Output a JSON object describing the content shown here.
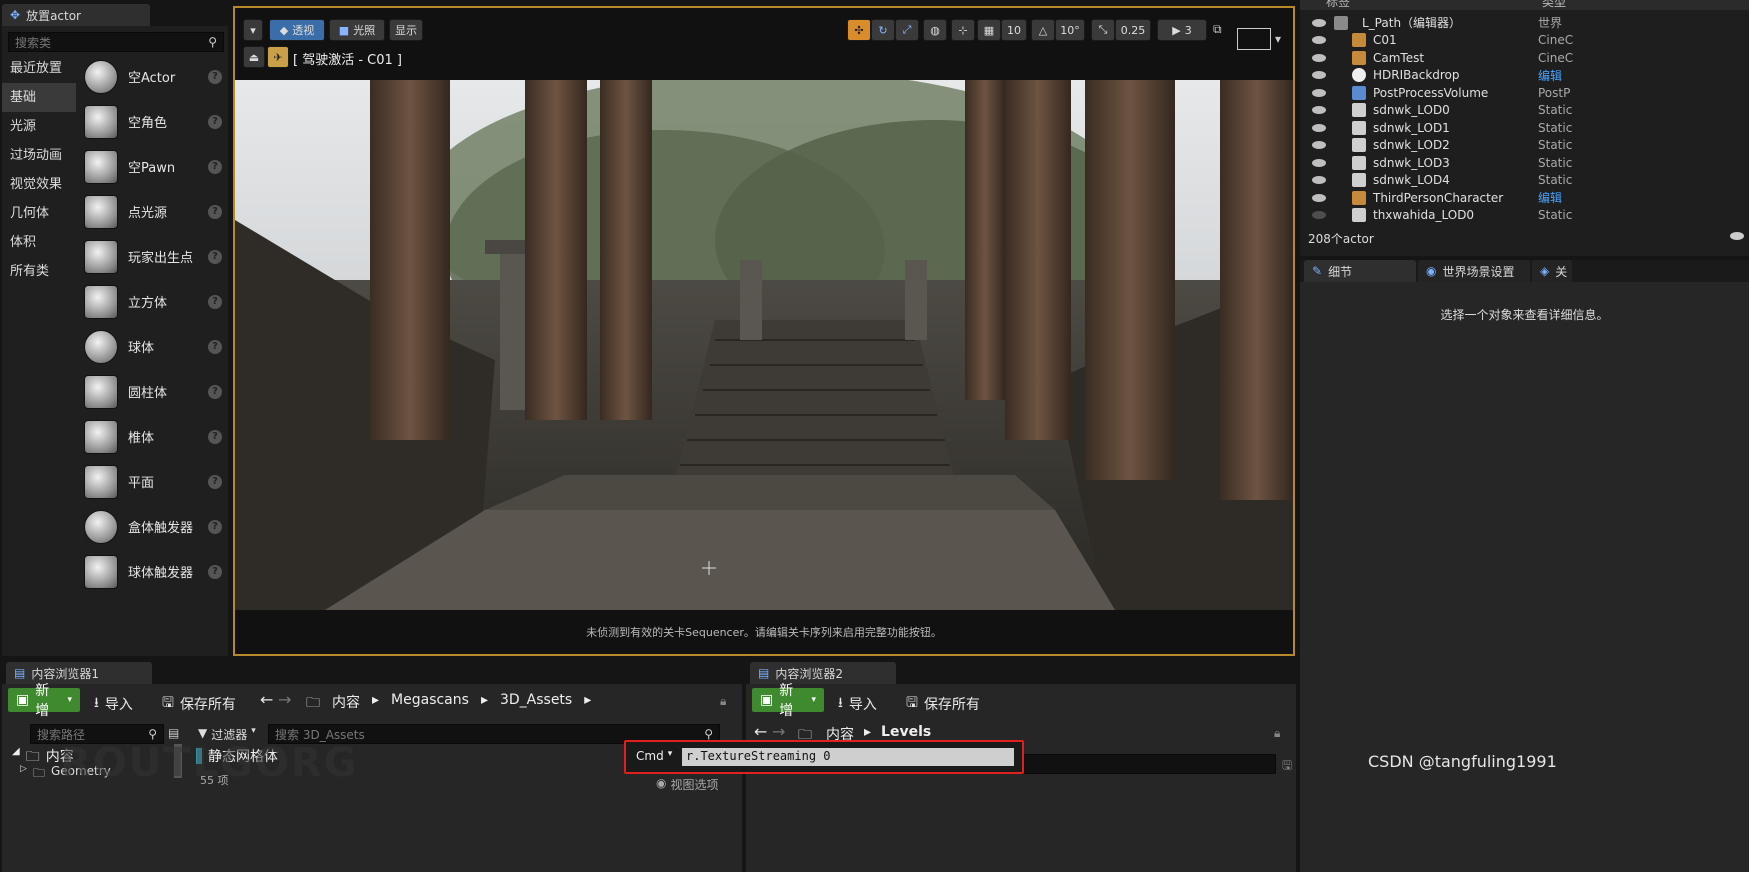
{
  "place_actors": {
    "tab_title": "放置actor",
    "search_placeholder": "搜索类",
    "categories": [
      "最近放置",
      "基础",
      "光源",
      "过场动画",
      "视觉效果",
      "几何体",
      "体积",
      "所有类"
    ],
    "selected_category": "基础",
    "items": [
      "空Actor",
      "空角色",
      "空Pawn",
      "点光源",
      "玩家出生点",
      "立方体",
      "球体",
      "圆柱体",
      "椎体",
      "平面",
      "盒体触发器",
      "球体触发器"
    ]
  },
  "viewport": {
    "perspective_label": "透视",
    "lit_label": "光照",
    "show_label": "显示",
    "pilot_label": "[ 驾驶激活 - C01 ]",
    "grid_snap": "10",
    "rotation_snap": "10°",
    "scale_snap": "0.25",
    "camera_speed": "3",
    "status_message": "未侦测到有效的关卡Sequencer。请编辑关卡序列来启用完整功能按钮。"
  },
  "outliner": {
    "col_label": "标签",
    "col_type": "类型",
    "rows": [
      {
        "name": "L_Path（编辑器）",
        "type": "世界"
      },
      {
        "name": "C01",
        "type": "CineC"
      },
      {
        "name": "CamTest",
        "type": "CineC"
      },
      {
        "name": "HDRIBackdrop",
        "type": "编辑"
      },
      {
        "name": "PostProcessVolume",
        "type": "PostP"
      },
      {
        "name": "sdnwk_LOD0",
        "type": "Static"
      },
      {
        "name": "sdnwk_LOD1",
        "type": "Static"
      },
      {
        "name": "sdnwk_LOD2",
        "type": "Static"
      },
      {
        "name": "sdnwk_LOD3",
        "type": "Static"
      },
      {
        "name": "sdnwk_LOD4",
        "type": "Static"
      },
      {
        "name": "ThirdPersonCharacter",
        "type": "编辑"
      },
      {
        "name": "thxwahida_LOD0",
        "type": "Static"
      }
    ],
    "actor_count": "208个actor"
  },
  "details": {
    "tab_details": "细节",
    "tab_world": "世界场景设置",
    "tab_third": "关",
    "empty_message": "选择一个对象来查看详细信息。"
  },
  "content_browser_1": {
    "tab_title": "内容浏览器1",
    "new_label": "新增",
    "import_label": "导入",
    "save_all_label": "保存所有",
    "breadcrumb": [
      "内容",
      "Megascans",
      "3D_Assets"
    ],
    "path_search_placeholder": "搜索路径",
    "filter_label": "过滤器",
    "asset_search_placeholder": "搜索 3D_Assets",
    "tree_root": "内容",
    "tree_child": "Geometry",
    "filter_chip": "静态网格体",
    "item_count": "55 项"
  },
  "content_browser_2": {
    "tab_title": "内容浏览器2",
    "new_label": "新增",
    "import_label": "导入",
    "save_all_label": "保存所有",
    "breadcrumb": [
      "内容",
      "Levels"
    ],
    "view_options": "视图选项"
  },
  "console": {
    "cmd_label": "Cmd",
    "command_value": "r.TextureStreaming 0"
  },
  "watermark": "CSDN @tangfuling1991",
  "colors": {
    "accent_orange": "#e8a33d",
    "new_button_green": "#3f8a2f",
    "highlight_red": "#e0201c",
    "selection_blue": "#4aa3ff"
  }
}
